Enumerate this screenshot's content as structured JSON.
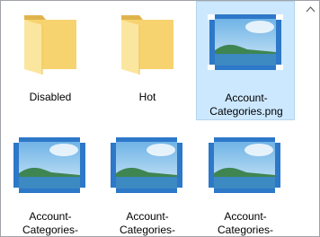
{
  "view": {
    "scroll_up_icon": "chevron-up-icon",
    "items": [
      {
        "name": "Disabled",
        "type": "folder",
        "icon": "folder-icon",
        "selected": false
      },
      {
        "name": "Hot",
        "type": "folder",
        "icon": "folder-icon",
        "selected": false
      },
      {
        "name_line1": "Account-",
        "name_line2": "Categories.png",
        "type": "image",
        "icon": "image-thumbnail-icon",
        "selected": true
      },
      {
        "name_line1": "Account-",
        "name_line2": "Categories-",
        "type": "image",
        "icon": "image-thumbnail-icon",
        "selected": false
      },
      {
        "name_line1": "Account-",
        "name_line2": "Categories-",
        "type": "image",
        "icon": "image-thumbnail-icon",
        "selected": false
      },
      {
        "name_line1": "Account-",
        "name_line2": "Categories-",
        "type": "image",
        "icon": "image-thumbnail-icon",
        "selected": false
      }
    ]
  },
  "colors": {
    "selection_bg": "#cce8ff",
    "folder": "#f8d775",
    "frame": "#1f6fc0"
  }
}
